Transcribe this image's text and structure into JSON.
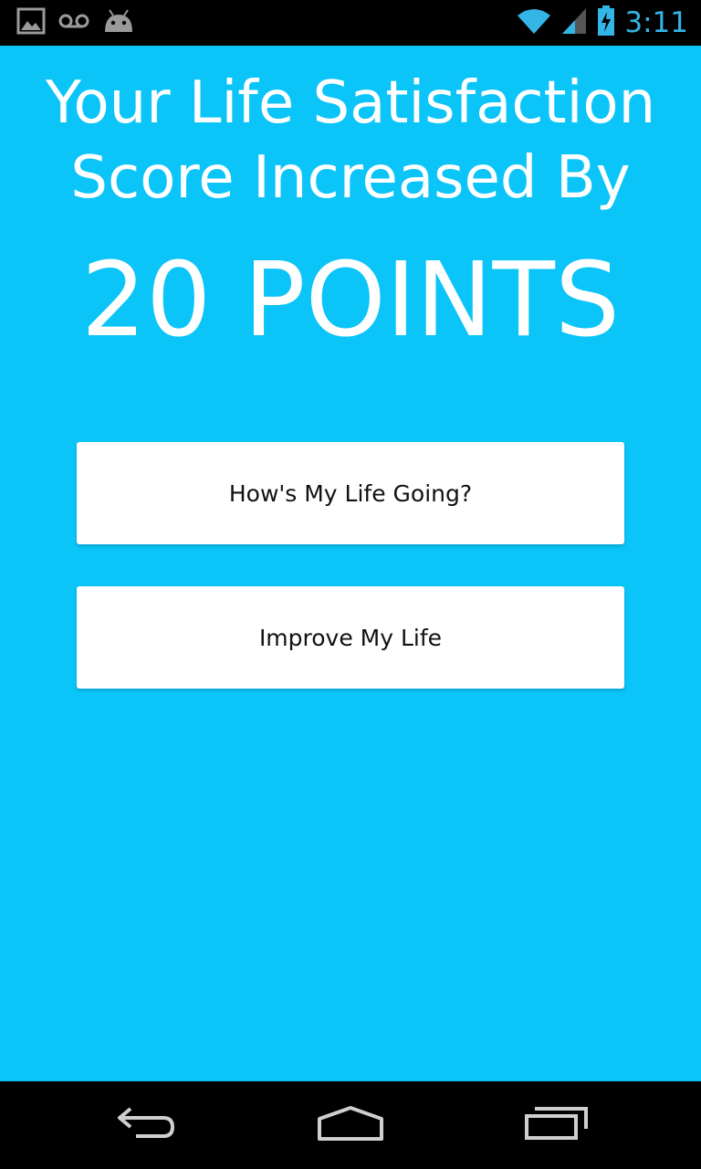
{
  "status_bar": {
    "time": "3:11",
    "icons": [
      "image-icon",
      "voicemail-icon",
      "android-icon",
      "wifi-icon",
      "signal-icon",
      "battery-charging-icon"
    ],
    "accent_color": "#33b5e5"
  },
  "main": {
    "headline": "Your Life Satisfaction Score Increased By",
    "points": "20 POINTS",
    "background_color": "#0bc4f8",
    "buttons": [
      {
        "label": "How's My Life Going?"
      },
      {
        "label": "Improve My Life"
      }
    ]
  },
  "nav_bar": {
    "icons": [
      "back-icon",
      "home-icon",
      "recent-apps-icon"
    ]
  }
}
